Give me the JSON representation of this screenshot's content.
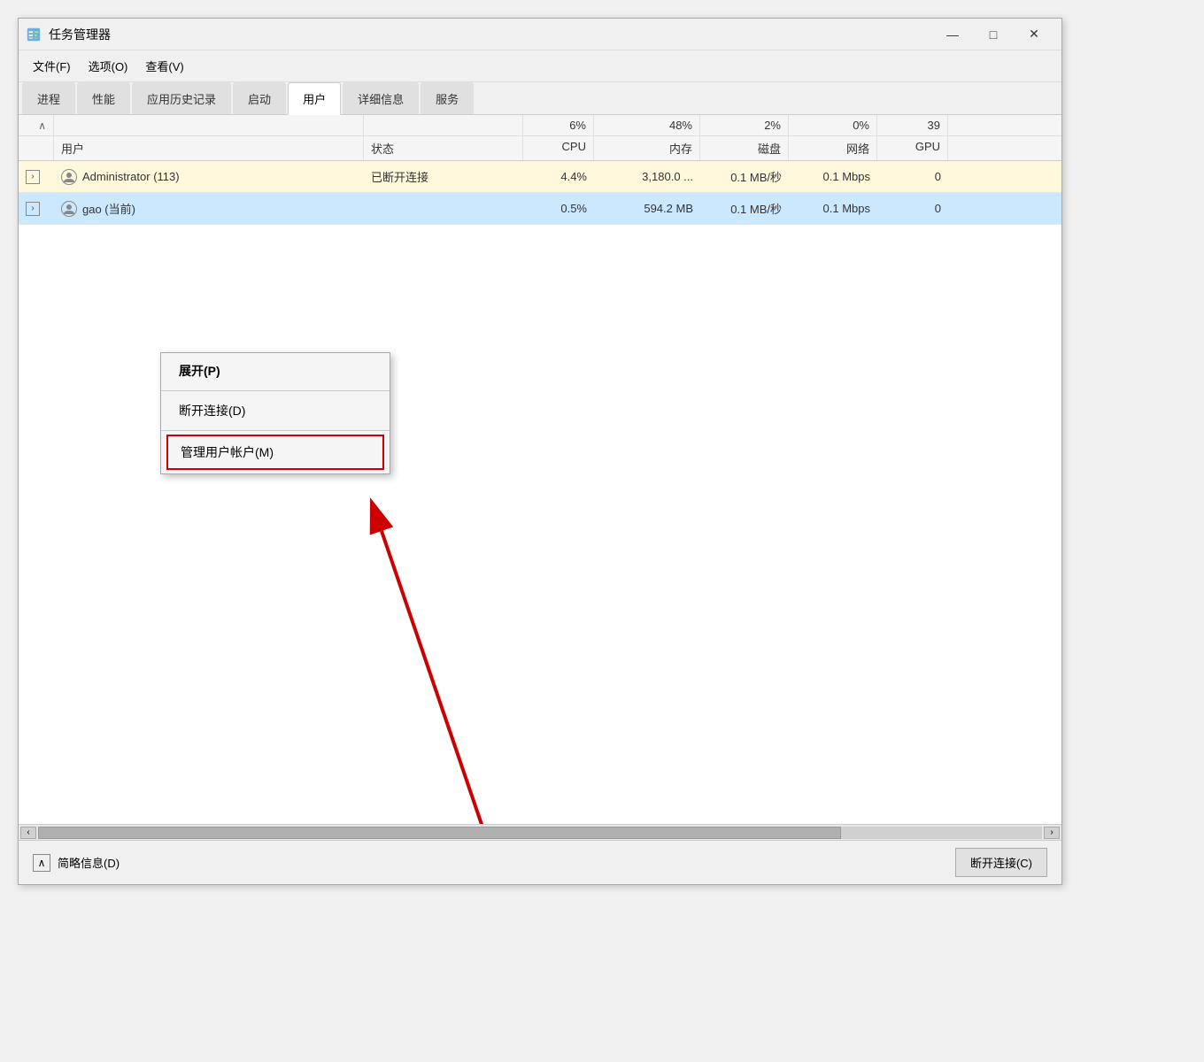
{
  "window": {
    "title": "任务管理器",
    "icon": "task-manager-icon"
  },
  "controls": {
    "minimize": "—",
    "maximize": "□",
    "close": "✕"
  },
  "menu": {
    "items": [
      "文件(F)",
      "选项(O)",
      "查看(V)"
    ]
  },
  "tabs": [
    {
      "label": "进程",
      "active": false
    },
    {
      "label": "性能",
      "active": false
    },
    {
      "label": "应用历史记录",
      "active": false
    },
    {
      "label": "启动",
      "active": false
    },
    {
      "label": "用户",
      "active": true
    },
    {
      "label": "详细信息",
      "active": false
    },
    {
      "label": "服务",
      "active": false
    }
  ],
  "table": {
    "header_row1": {
      "cols": [
        "",
        "",
        "",
        "6%",
        "48%",
        "2%",
        "0%",
        "39"
      ]
    },
    "header_row2": {
      "user_col": "用户",
      "status_col": "状态",
      "cpu_col": "CPU",
      "memory_col": "内存",
      "disk_col": "磁盘",
      "network_col": "网络",
      "gpu_col": "GPU"
    },
    "rows": [
      {
        "id": 1,
        "expand": ">",
        "user": "Administrator (113)",
        "status": "已断开连接",
        "cpu": "4.4%",
        "memory": "3,180.0 ...",
        "disk": "0.1 MB/秒",
        "network": "0.1 Mbps",
        "gpu": "0",
        "highlighted": true
      },
      {
        "id": 2,
        "expand": ">",
        "user": "gao (当前)",
        "status": "",
        "cpu": "0.5%",
        "memory": "594.2 MB",
        "disk": "0.1 MB/秒",
        "network": "0.1 Mbps",
        "gpu": "0",
        "highlighted": false,
        "selected": true
      }
    ]
  },
  "context_menu": {
    "items": [
      {
        "label": "展开(P)",
        "bold": true
      },
      {
        "label": "断开连接(D)",
        "separator_before": false
      },
      {
        "label": "管理用户帐户(M)",
        "highlighted": true
      }
    ]
  },
  "bottom_bar": {
    "toggle_label": "简略信息(D)",
    "disconnect_btn": "断开连接(C)"
  }
}
